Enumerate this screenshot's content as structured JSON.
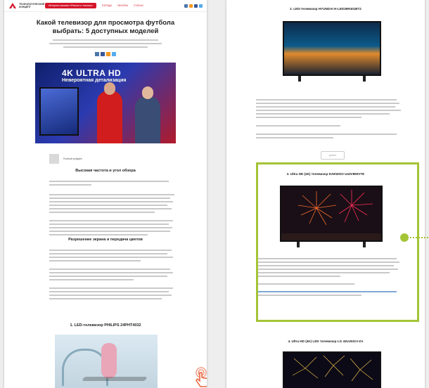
{
  "left": {
    "header": {
      "logo_text": "ТЕХНОЛОГИЧЕСКИЙ\nКОНЦЕПТ",
      "promo": "Интернет-магазин «Ремонт и техника»",
      "nav": [
        "ГОРОДА",
        "ОБЗОРЫ",
        "СТАТЬИ"
      ]
    },
    "article": {
      "title": "Какой телевизор для просмотра футбола выбрать: 5 доступных моделей",
      "hero_big": "4K ULTRA HD",
      "hero_sub": "Невероятная детализация",
      "author": "Полный рейдинг",
      "section1": "Высокая частота и угол обзора",
      "section2": "Разрешение экрана и передача цветов",
      "model1": "1. LED-телевизор PHILIPS 24PHT4032"
    }
  },
  "right": {
    "model2": "2. LED-телевизор HYUNDAI H-LED39R401BT2",
    "button": "купить",
    "model3": "3. Ultra HD (4K) телевизор DAEWOO U43V890VTE",
    "model4": "4. Ultra HD (4K) LED телевизор LG 43UJ631V-ZA"
  },
  "colors": {
    "brand_red": "#d4162b",
    "highlight_green": "#a4c436"
  },
  "icons": [
    "logo-mark-icon",
    "social-icons",
    "share-icons",
    "hand-cursor-icon",
    "pointer-dot-icon"
  ]
}
